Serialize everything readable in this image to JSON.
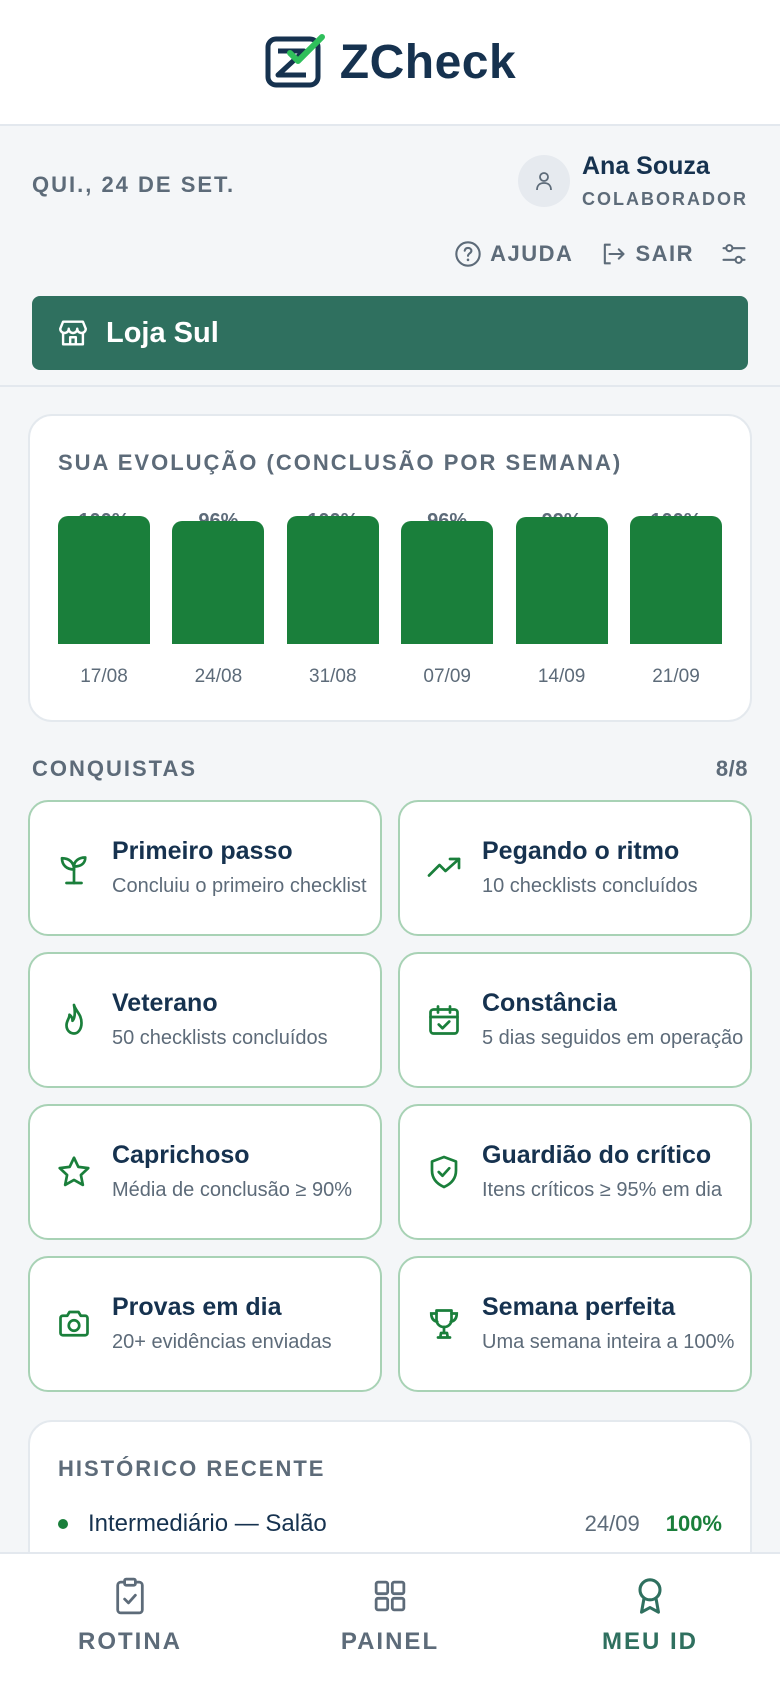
{
  "app": {
    "name": "ZCheck"
  },
  "header": {
    "date": "QUI., 24 DE SET."
  },
  "user": {
    "name": "Ana Souza",
    "role": "COLABORADOR"
  },
  "actions": {
    "help": "AJUDA",
    "logout": "SAIR"
  },
  "store": {
    "name": "Loja Sul"
  },
  "chart_data": {
    "type": "bar",
    "title": "SUA EVOLUÇÃO (CONCLUSÃO POR SEMANA)",
    "categories": [
      "17/08",
      "24/08",
      "31/08",
      "07/09",
      "14/09",
      "21/09"
    ],
    "values": [
      100,
      96,
      100,
      96,
      99,
      100
    ],
    "value_labels": [
      "100%",
      "96%",
      "100%",
      "96%",
      "99%",
      "100%"
    ],
    "ylim": [
      0,
      100
    ],
    "color": "#1a7f3b"
  },
  "achievements": {
    "title": "CONQUISTAS",
    "count": "8/8",
    "items": [
      {
        "icon": "sprout-icon",
        "title": "Primeiro passo",
        "desc": "Concluiu o primeiro checklist"
      },
      {
        "icon": "trending-up-icon",
        "title": "Pegando o ritmo",
        "desc": "10 checklists concluídos"
      },
      {
        "icon": "flame-icon",
        "title": "Veterano",
        "desc": "50 checklists concluídos"
      },
      {
        "icon": "calendar-check-icon",
        "title": "Constância",
        "desc": "5 dias seguidos em operação"
      },
      {
        "icon": "star-icon",
        "title": "Caprichoso",
        "desc": "Média de conclusão ≥ 90%"
      },
      {
        "icon": "shield-check-icon",
        "title": "Guardião do crítico",
        "desc": "Itens críticos ≥ 95% em dia"
      },
      {
        "icon": "camera-icon",
        "title": "Provas em dia",
        "desc": "20+ evidências enviadas"
      },
      {
        "icon": "trophy-icon",
        "title": "Semana perfeita",
        "desc": "Uma semana inteira a 100%"
      }
    ]
  },
  "history": {
    "title": "HISTÓRICO RECENTE",
    "items": [
      {
        "label": "Intermediário — Salão",
        "date": "24/09",
        "pct": "100%"
      }
    ]
  },
  "nav": {
    "items": [
      {
        "label": "ROTINA",
        "icon": "clipboard-check-icon"
      },
      {
        "label": "PAINEL",
        "icon": "grid-icon"
      },
      {
        "label": "MEU ID",
        "icon": "award-icon",
        "active": true
      }
    ]
  },
  "colors": {
    "accent": "#2f705f",
    "success": "#1a7f3b",
    "text": "#16324f",
    "muted": "#5d6b79"
  }
}
